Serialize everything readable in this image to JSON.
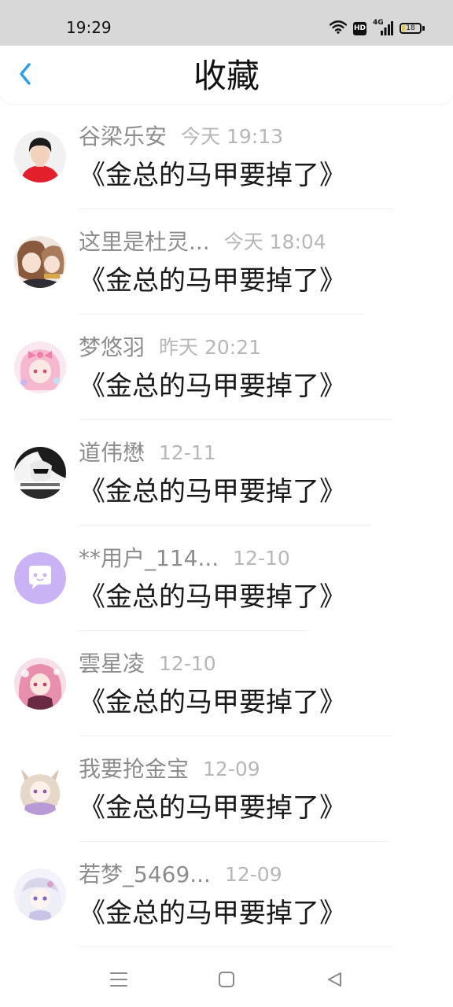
{
  "status_bar": {
    "time": "19:29",
    "network_label": "4G",
    "hd_label": "HD",
    "battery_level": "18",
    "icons": [
      "wifi-icon",
      "hd-icon",
      "signal-icon",
      "battery-icon"
    ]
  },
  "header": {
    "title": "收藏",
    "back_icon": "chevron-left-icon",
    "accent_color": "#2b9fe8"
  },
  "favorites": [
    {
      "nickname": "谷梁乐安",
      "time": "今天 19:13",
      "title": "《金总的马甲要掉了》",
      "avatar": "avatar-boy-red-shirt"
    },
    {
      "nickname": "这里是杜灵...",
      "time": "今天 18:04",
      "title": "《金总的马甲要掉了》",
      "avatar": "avatar-anime-girls"
    },
    {
      "nickname": "梦悠羽",
      "time": "昨天 20:21",
      "title": "《金总的马甲要掉了》",
      "avatar": "avatar-anime-pink-bow"
    },
    {
      "nickname": "道伟懋",
      "time": "12-11",
      "title": "《金总的马甲要掉了》",
      "avatar": "avatar-black-white"
    },
    {
      "nickname": "**用户_114...",
      "time": "12-10",
      "title": "《金总的马甲要掉了》",
      "avatar": "avatar-default-purple-chat"
    },
    {
      "nickname": "雲星凌",
      "time": "12-10",
      "title": "《金总的马甲要掉了》",
      "avatar": "avatar-anime-pink-hair"
    },
    {
      "nickname": "我要抢金宝",
      "time": "12-09",
      "title": "《金总的马甲要掉了》",
      "avatar": "avatar-anime-cat-ears"
    },
    {
      "nickname": "若梦_5469...",
      "time": "12-09",
      "title": "《金总的马甲要掉了》",
      "avatar": "avatar-anime-white-hair"
    }
  ],
  "nav_bar": {
    "icons": [
      "menu-icon",
      "home-square-icon",
      "back-triangle-icon"
    ]
  },
  "colors": {
    "nickname": "#8d8d8d",
    "timestamp": "#b7b7b7",
    "status_bar_bg": "#d8d8d8",
    "default_avatar": "#c9b3f5"
  }
}
